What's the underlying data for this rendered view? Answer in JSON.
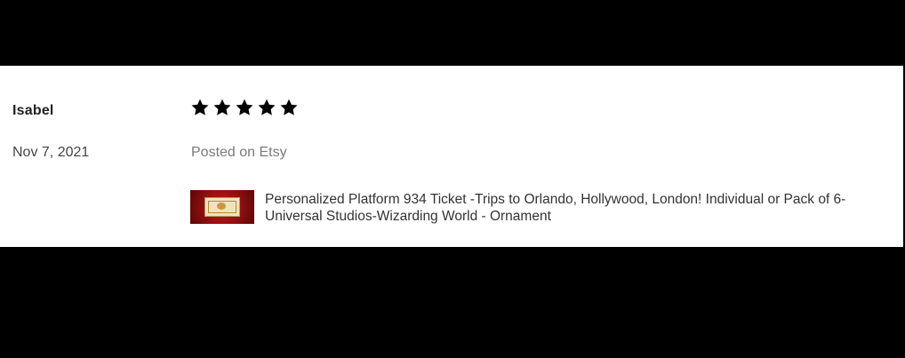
{
  "review": {
    "reviewer_name": "Isabel",
    "date": "Nov 7, 2021",
    "rating": 5,
    "rating_max": 5,
    "posted_on": "Posted on Etsy",
    "product": {
      "title": "Personalized Platform 934 Ticket -Trips to Orlando, Hollywood, London! Individual or Pack of 6- Universal Studios-Wizarding World - Ornament",
      "thumbnail": "product-thumbnail"
    }
  },
  "colors": {
    "background": "#000000",
    "card": "#ffffff",
    "star": "#000000",
    "muted_text": "#7a7a7a",
    "thumbnail_red": "#b31616"
  }
}
